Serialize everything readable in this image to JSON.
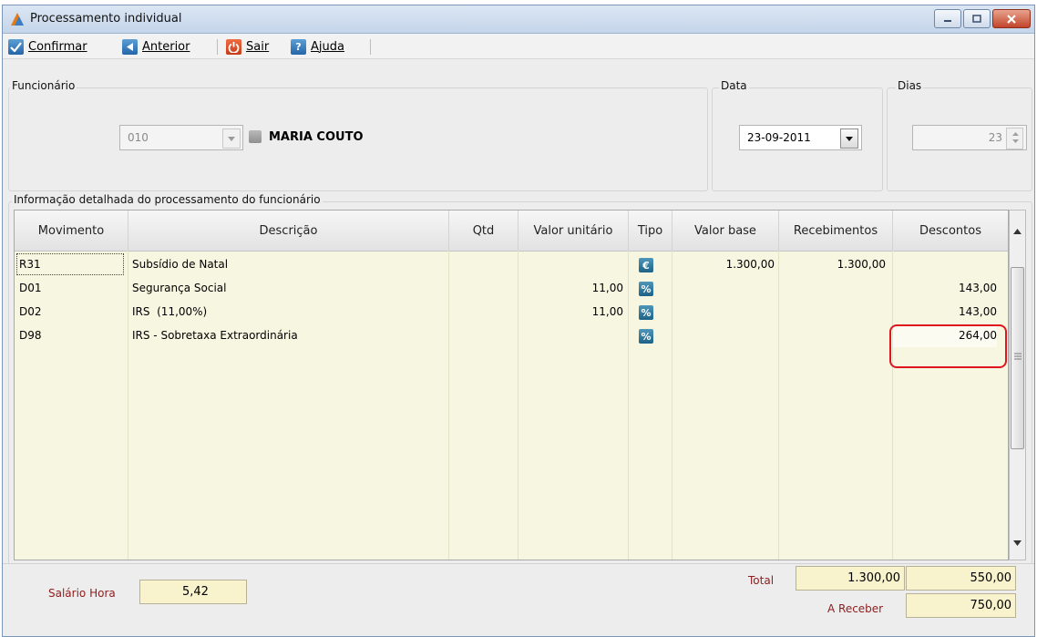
{
  "window": {
    "title": "Processamento individual"
  },
  "toolbar": {
    "confirmar": "Confirmar",
    "anterior": "Anterior",
    "sair": "Sair",
    "ajuda": "Ajuda"
  },
  "funcionario": {
    "group_label": "Funcionário",
    "code": "010",
    "name": "MARIA COUTO"
  },
  "data": {
    "group_label": "Data",
    "value": "23-09-2011"
  },
  "dias": {
    "group_label": "Dias",
    "value": "23"
  },
  "detail": {
    "group_label": "Informação detalhada do processamento do funcionário",
    "columns": [
      "Movimento",
      "Descrição",
      "Qtd",
      "Valor unitário",
      "Tipo",
      "Valor base",
      "Recebimentos",
      "Descontos"
    ],
    "rows": [
      {
        "movimento": "R31",
        "descricao": "Subsídio de Natal",
        "qtd": "",
        "valor_unitario": "",
        "tipo_icon": "euro-icon",
        "valor_base": "1.300,00",
        "recebimentos": "1.300,00",
        "descontos": ""
      },
      {
        "movimento": "D01",
        "descricao": "Segurança Social",
        "qtd": "",
        "valor_unitario": "11,00",
        "tipo_icon": "percent-icon",
        "valor_base": "",
        "recebimentos": "",
        "descontos": "143,00"
      },
      {
        "movimento": "D02",
        "descricao": "IRS  (11,00%)",
        "qtd": "",
        "valor_unitario": "11,00",
        "tipo_icon": "percent-icon",
        "valor_base": "",
        "recebimentos": "",
        "descontos": "143,00"
      },
      {
        "movimento": "D98",
        "descricao": "IRS - Sobretaxa Extraordinária",
        "qtd": "",
        "valor_unitario": "",
        "tipo_icon": "percent-icon",
        "valor_base": "",
        "recebimentos": "",
        "descontos": "264,00"
      }
    ]
  },
  "footer": {
    "salario_hora_label": "Salário Hora",
    "salario_hora_value": "5,42",
    "total_label": "Total",
    "total_recebimentos": "1.300,00",
    "total_descontos": "550,00",
    "a_receber_label": "A Receber",
    "a_receber_value": "750,00"
  },
  "colors": {
    "highlight": "#e0161f",
    "grid_bg": "#f7f6e1",
    "red_label": "#8c1d1d"
  }
}
